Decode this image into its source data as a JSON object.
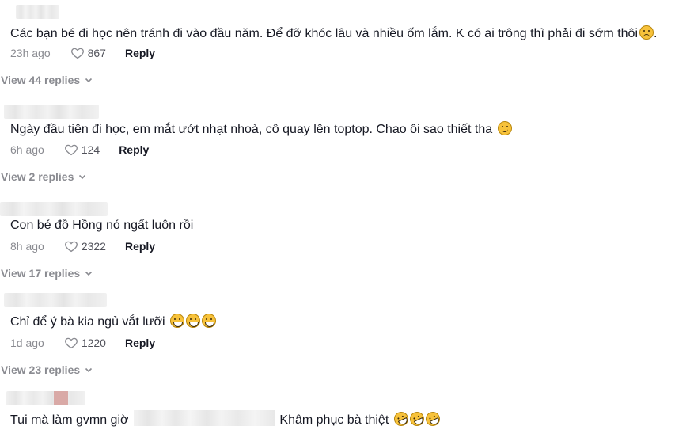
{
  "comments": [
    {
      "text": "Các bạn bé đi học nên tránh đi vào đầu năm. Để đỡ khóc lâu và nhiều ốm lắm. K có ai trông thì phải đi sớm thôi",
      "time": "23h ago",
      "likes": "867",
      "reply_label": "Reply",
      "view_replies": "View 44 replies"
    },
    {
      "text": "Ngày đầu tiên đi học, em mắt ướt nhạt nhoà, cô quay lên toptop. Chao ôi sao thiết tha",
      "time": "6h ago",
      "likes": "124",
      "reply_label": "Reply",
      "view_replies": "View 2 replies"
    },
    {
      "text": "Con bé đồ Hồng nó ngất luôn rồi",
      "time": "8h ago",
      "likes": "2322",
      "reply_label": "Reply",
      "view_replies": "View 17 replies"
    },
    {
      "text": "Chỉ để ý bà kia ngủ vắt lưỡi",
      "time": "1d ago",
      "likes": "1220",
      "reply_label": "Reply",
      "view_replies": "View 23 replies"
    },
    {
      "text_before": "Tui mà làm gvmn giờ",
      "text_after": "Khâm phục bà thiệt"
    }
  ],
  "icons": {
    "like": "heart-outline-icon",
    "expand": "chevron-down-icon",
    "emoji_colors": {
      "face": "#f7c23b",
      "outline": "#b8860b"
    }
  },
  "colors": {
    "text_primary": "#161823",
    "text_secondary": "#8a8b91"
  }
}
